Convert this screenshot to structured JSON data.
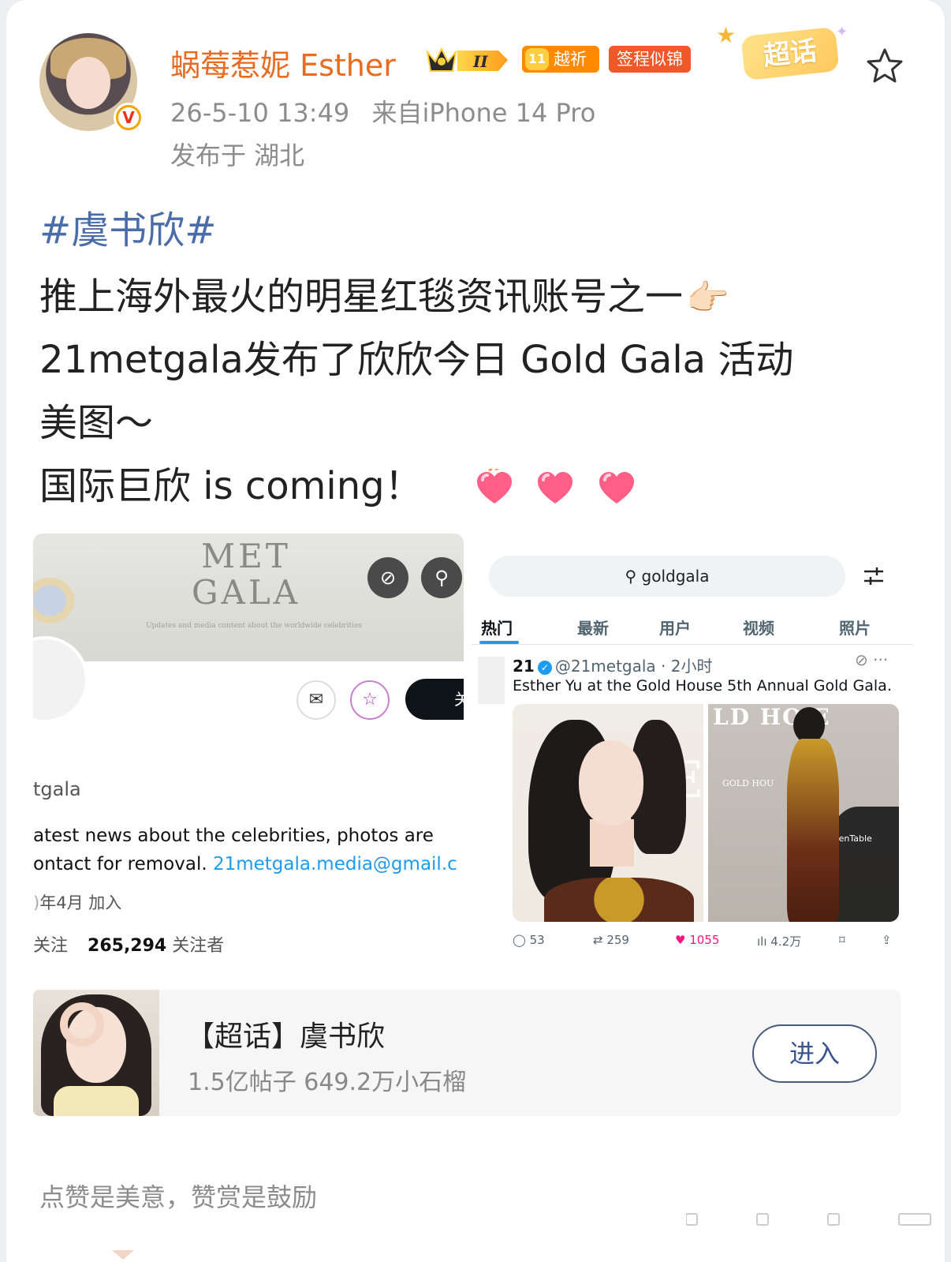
{
  "post": {
    "author_name": "蜗莓惹妮 Esther",
    "badges": {
      "crown_level": "II",
      "level_label": "越祈",
      "sign_label": "签程似锦",
      "supertopic_label": "超话"
    },
    "timestamp": "26-5-10 13:49",
    "source": "来自iPhone 14 Pro",
    "location": "发布于 湖北",
    "topic_tag": "#虞书欣#",
    "lines": [
      "推上海外最火的明星红毯资讯账号之一",
      "21metgala发布了欣欣今日 Gold Gala 活动",
      "美图～",
      "国际巨欣 is coming！"
    ],
    "emoji": {
      "pointing_hand": "👉🏻",
      "heart_count": 3
    }
  },
  "image1": {
    "banner_title_1": "MET",
    "banner_title_2": "GALA",
    "banner_subtitle": "Updates and media content about the worldwide celebrities",
    "follow_partial": "关",
    "handle": "tgala",
    "bio_line1": "atest news about the celebrities, photos are",
    "bio_line2_prefix": "ontact for removal. ",
    "bio_email": "21metgala.media@gmail.c",
    "joined": "年4月 加入",
    "following_suffix": "关注",
    "followers_count": "265,294",
    "followers_label": "关注者"
  },
  "image2": {
    "search_query": "goldgala",
    "tabs": [
      "热门",
      "最新",
      "用户",
      "视频",
      "照片"
    ],
    "active_tab": "热门",
    "tweet_name": "21",
    "tweet_handle_time": "@21metgala · 2小时",
    "tweet_text": "Esther Yu at the Gold House 5th Annual Gold Gala.",
    "photo_b_wall": "LD HO  E",
    "photo_b_gold": "GOLD HOU",
    "photo_b_logo": "OpenTable",
    "actions": {
      "replies": "53",
      "retweets": "259",
      "likes": "1055",
      "views": "4.2万"
    }
  },
  "supertopic": {
    "title": "【超话】虞书欣",
    "stats": "1.5亿帖子 649.2万小石榴",
    "enter_label": "进入"
  },
  "reward_text": "点赞是美意，赞赏是鼓励",
  "colors": {
    "author_name": "#e86b20",
    "topic_link": "#4a6ca8",
    "meta_gray": "#8c8c8c",
    "twitter_blue": "#1d9bf0",
    "like_pink": "#f91880"
  }
}
